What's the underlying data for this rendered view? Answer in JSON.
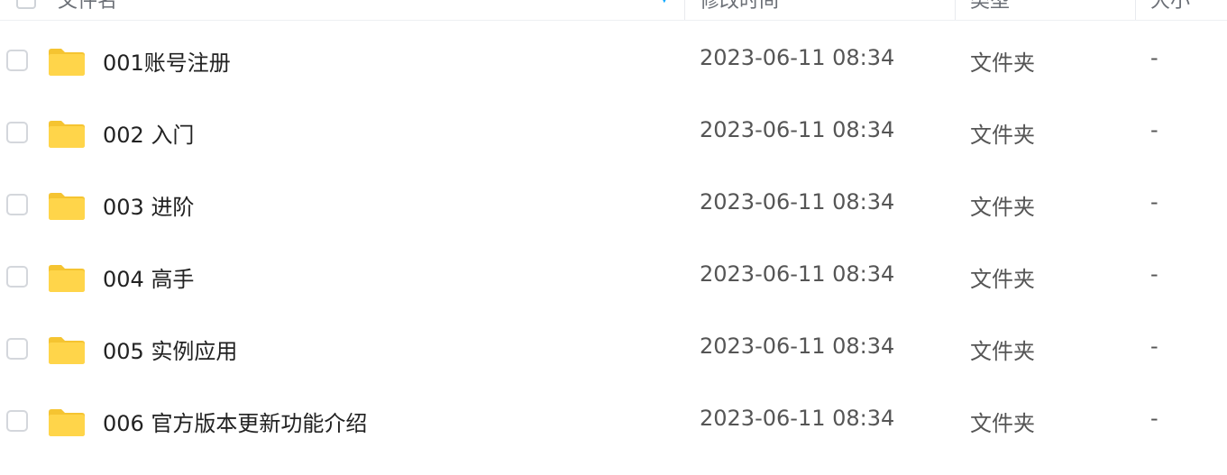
{
  "header": {
    "columns": [
      "文件名",
      "修改时间",
      "类型",
      "大小"
    ]
  },
  "colors": {
    "folder": "#FFD54A",
    "folder_tab": "#F5C431",
    "sort_accent": "#06A7FF"
  },
  "rows": [
    {
      "name": "001账号注册",
      "modified": "2023-06-11 08:34",
      "type": "文件夹",
      "size": "-",
      "icon": "folder-icon"
    },
    {
      "name": "002 入门",
      "modified": "2023-06-11 08:34",
      "type": "文件夹",
      "size": "-",
      "icon": "folder-icon"
    },
    {
      "name": "003 进阶",
      "modified": "2023-06-11 08:34",
      "type": "文件夹",
      "size": "-",
      "icon": "folder-icon"
    },
    {
      "name": "004 高手",
      "modified": "2023-06-11 08:34",
      "type": "文件夹",
      "size": "-",
      "icon": "folder-icon"
    },
    {
      "name": "005 实例应用",
      "modified": "2023-06-11 08:34",
      "type": "文件夹",
      "size": "-",
      "icon": "folder-icon"
    },
    {
      "name": "006 官方版本更新功能介绍",
      "modified": "2023-06-11 08:34",
      "type": "文件夹",
      "size": "-",
      "icon": "folder-icon"
    }
  ]
}
